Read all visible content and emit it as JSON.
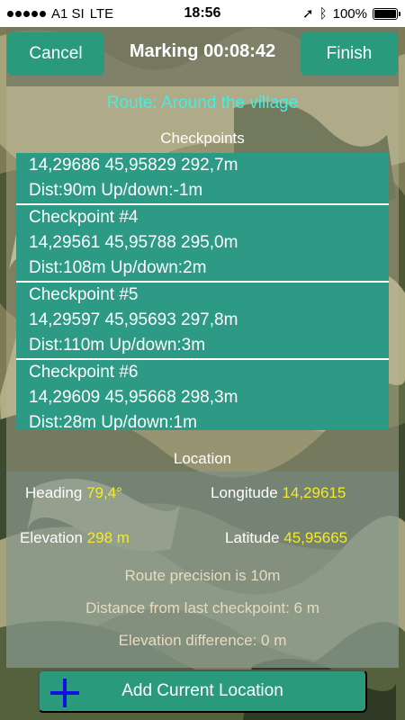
{
  "status_bar": {
    "carrier": "A1 SI",
    "network": "LTE",
    "time": "18:56",
    "battery": "100%"
  },
  "header": {
    "cancel_label": "Cancel",
    "title": "Marking 00:08:42",
    "finish_label": "Finish"
  },
  "route": {
    "title": "Route: Around the village"
  },
  "checkpoints": {
    "label": "Checkpoints",
    "items": [
      {
        "name": "",
        "coords": "14,29686 45,95829 292,7m",
        "dist": "Dist:90m Up/down:-1m"
      },
      {
        "name": "Checkpoint #4",
        "coords": "14,29561 45,95788 295,0m",
        "dist": "Dist:108m Up/down:2m"
      },
      {
        "name": "Checkpoint #5",
        "coords": "14,29597 45,95693 297,8m",
        "dist": "Dist:110m Up/down:3m"
      },
      {
        "name": "Checkpoint #6",
        "coords": "14,29609 45,95668 298,3m",
        "dist": "Dist:28m Up/down:1m"
      }
    ]
  },
  "location": {
    "label": "Location",
    "heading_label": "Heading",
    "heading_value": "79,4°",
    "longitude_label": "Longitude",
    "longitude_value": "14,29615",
    "elevation_label": "Elevation",
    "elevation_value": "298 m",
    "latitude_label": "Latitude",
    "latitude_value": "45,95665",
    "precision_text": "Route precision is 10m",
    "distance_text": "Distance from last checkpoint: 6 m",
    "elevation_diff_text": "Elevation difference: 0 m"
  },
  "actions": {
    "add_label": "Add Current Location"
  },
  "colors": {
    "button": "#2a9a7c",
    "checkpoint_bg": "#2d9a86",
    "route_title": "#3ff0e4",
    "value_highlight": "#f3ea2b",
    "plus_icon": "#1212e0"
  }
}
